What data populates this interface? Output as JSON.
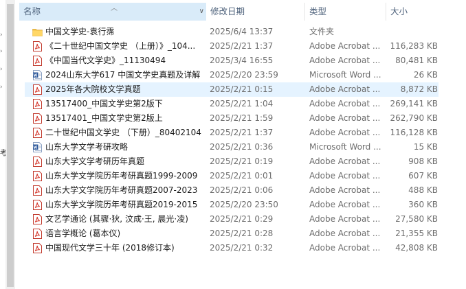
{
  "columns": {
    "name": "名称",
    "date": "修改日期",
    "type": "类型",
    "size": "大小"
  },
  "left_cut_text": "考",
  "files": [
    {
      "icon": "folder-icon",
      "name": "中国文学史-袁行霈",
      "date": "2025/6/4 13:37",
      "type": "文件夹",
      "size": ""
    },
    {
      "icon": "pdf-icon",
      "name": "《二十世纪中国文学史 （上册）》_104...",
      "date": "2025/2/21 1:37",
      "type": "Adobe Acrobat ...",
      "size": "116,283 KB"
    },
    {
      "icon": "pdf-icon",
      "name": "《中国当代文学史》_11130494",
      "date": "2025/3/4 16:55",
      "type": "Adobe Acrobat ...",
      "size": "80,481 KB"
    },
    {
      "icon": "word-icon",
      "name": "2024山东大学617 中国文学史真题及详解",
      "date": "2025/2/20 23:59",
      "type": "Microsoft Word ...",
      "size": "26 KB"
    },
    {
      "icon": "pdf-icon",
      "name": "2025年各大院校文学真题",
      "date": "2025/2/21 0:15",
      "type": "Adobe Acrobat ...",
      "size": "8,872 KB",
      "selected": true
    },
    {
      "icon": "pdf-icon",
      "name": "13517400_中国文学史第2版下",
      "date": "2025/2/21 1:04",
      "type": "Adobe Acrobat ...",
      "size": "269,141 KB"
    },
    {
      "icon": "pdf-icon",
      "name": "13517401_中国文学史第2版上",
      "date": "2025/2/21 1:59",
      "type": "Adobe Acrobat ...",
      "size": "262,790 KB"
    },
    {
      "icon": "pdf-icon",
      "name": "二十世纪中国文学史 （下册）_80402104",
      "date": "2025/2/21 1:37",
      "type": "Adobe Acrobat ...",
      "size": "116,128 KB"
    },
    {
      "icon": "word-icon",
      "name": "山东大学文学考研攻略",
      "date": "2025/2/21 0:36",
      "type": "Microsoft Word ...",
      "size": "15 KB"
    },
    {
      "icon": "pdf-icon",
      "name": "山东大学文学考研历年真题",
      "date": "2025/2/21 0:19",
      "type": "Adobe Acrobat ...",
      "size": "908 KB"
    },
    {
      "icon": "pdf-icon",
      "name": "山东大学文学院历年考研真题1999-2009",
      "date": "2025/2/21 0:01",
      "type": "Adobe Acrobat ...",
      "size": "607 KB"
    },
    {
      "icon": "pdf-icon",
      "name": "山东大学文学院历年考研真题2007-2023",
      "date": "2025/2/21 0:06",
      "type": "Adobe Acrobat ...",
      "size": "488 KB"
    },
    {
      "icon": "pdf-icon",
      "name": "山东大学文学院历年考研真题2019-2015",
      "date": "2025/2/20 23:50",
      "type": "Adobe Acrobat ...",
      "size": "360 KB"
    },
    {
      "icon": "pdf-icon",
      "name": "文艺学通论 (其骤·狄, 汶成·王, 晨光·凌)",
      "date": "2025/2/21 0:29",
      "type": "Adobe Acrobat ...",
      "size": "27,580 KB"
    },
    {
      "icon": "pdf-icon",
      "name": "语言学概论 (葛本仪)",
      "date": "2025/2/21 0:28",
      "type": "Adobe Acrobat ...",
      "size": "21,355 KB"
    },
    {
      "icon": "pdf-icon",
      "name": "中国现代文学三十年 (2018修订本)",
      "date": "2025/2/21 0:32",
      "type": "Adobe Acrobat ...",
      "size": "42,808 KB"
    }
  ],
  "colors": {
    "folder": "#f4c64e",
    "pdf": "#d63a2f",
    "word": "#2b579a",
    "selection": "#e5f3ff",
    "header_active": "#d9ebf9"
  }
}
